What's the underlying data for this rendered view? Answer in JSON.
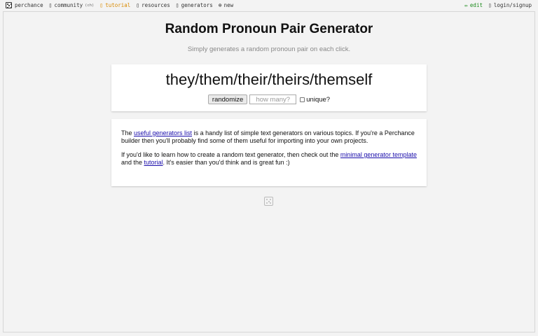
{
  "nav": {
    "left": [
      {
        "label": "perchance"
      },
      {
        "label": "community",
        "badge": "(ch)"
      },
      {
        "label": "tutorial"
      },
      {
        "label": "resources"
      },
      {
        "label": "generators"
      },
      {
        "label": "new"
      }
    ],
    "right": [
      {
        "label": "edit"
      },
      {
        "label": "login/signup"
      }
    ]
  },
  "icons": {
    "logo": "dice-icon",
    "community": "chat-icon",
    "tutorial": "info-icon",
    "resources": "book-icon",
    "generators": "grid-icon",
    "new": "plus-circle-icon",
    "edit": "pencil-icon",
    "login": "user-icon"
  },
  "colors": {
    "tutorial": "#d98a00",
    "edit": "#1a8a1a",
    "link": "#1a0dab"
  },
  "page": {
    "title": "Random Pronoun Pair Generator",
    "subtitle": "Simply generates a random pronoun pair on each click."
  },
  "output": {
    "text": "they/them/their/theirs/themself",
    "randomize_label": "randomize",
    "count_placeholder": "how many?",
    "count_value": "",
    "unique_label": "unique?",
    "unique_checked": false
  },
  "info": {
    "p1_prefix": "The ",
    "p1_link": "useful generators list",
    "p1_suffix": " is a handy list of simple text generators on various topics. If you're a Perchance builder then you'll probably find some of them useful for importing into your own projects.",
    "p2_prefix": "If you'd like to learn how to create a random text generator, then check out the ",
    "p2_link1": "minimal generator template",
    "p2_middle": " and the ",
    "p2_link2": "tutorial",
    "p2_suffix": ". It's easier than you'd think and is great fun :)"
  }
}
